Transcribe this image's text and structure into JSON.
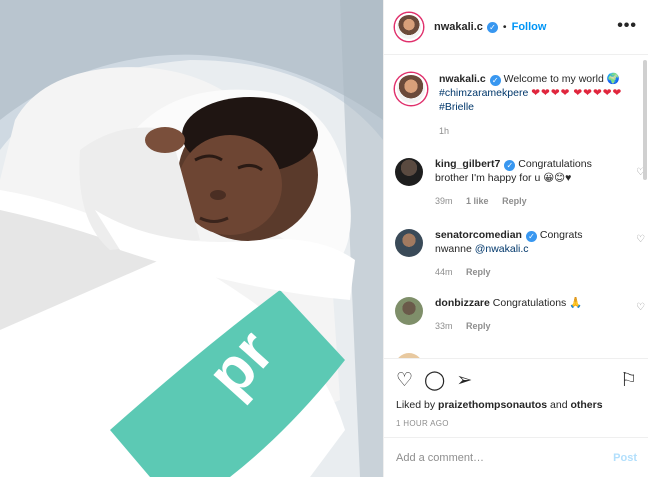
{
  "header": {
    "username": "nwakali.c",
    "follow_label": "Follow",
    "dot": "•",
    "more": "•••"
  },
  "caption": {
    "username": "nwakali.c",
    "text_before": "Welcome to my world",
    "globe": "🌍",
    "hashtag1": "#chimzaramekpere",
    "hearts1": "❤❤❤❤",
    "hearts2": "❤❤❤❤❤",
    "hashtag2": "#Brielle",
    "time": "1h"
  },
  "comments": [
    {
      "username": "king_gilbert7",
      "verified": true,
      "text": "Congratulations brother I'm happy for u 😀😊♥",
      "time": "39m",
      "likes": "1 like",
      "reply": "Reply"
    },
    {
      "username": "senatorcomedian",
      "verified": true,
      "text_before": "Congrats nwanne ",
      "mention": "@nwakali.c",
      "time": "44m",
      "reply": "Reply"
    },
    {
      "username": "donbizzare",
      "verified": false,
      "text": "Congratulations 🙏",
      "time": "33m",
      "reply": "Reply"
    }
  ],
  "actions": {
    "liked_by_prefix": "Liked by ",
    "liked_by_user": "praizethompsonautos",
    "liked_by_and": " and ",
    "liked_by_others": "others",
    "time": "1 HOUR AGO",
    "comment_placeholder": "Add a comment…",
    "post_label": "Post"
  },
  "colors": {
    "accent": "#0095f6",
    "verified": "#3897f0",
    "blanket_band": "#5cc9b4"
  },
  "icons": [
    "heart-icon",
    "comment-icon",
    "share-icon",
    "bookmark-icon",
    "more-icon",
    "verified-icon"
  ]
}
